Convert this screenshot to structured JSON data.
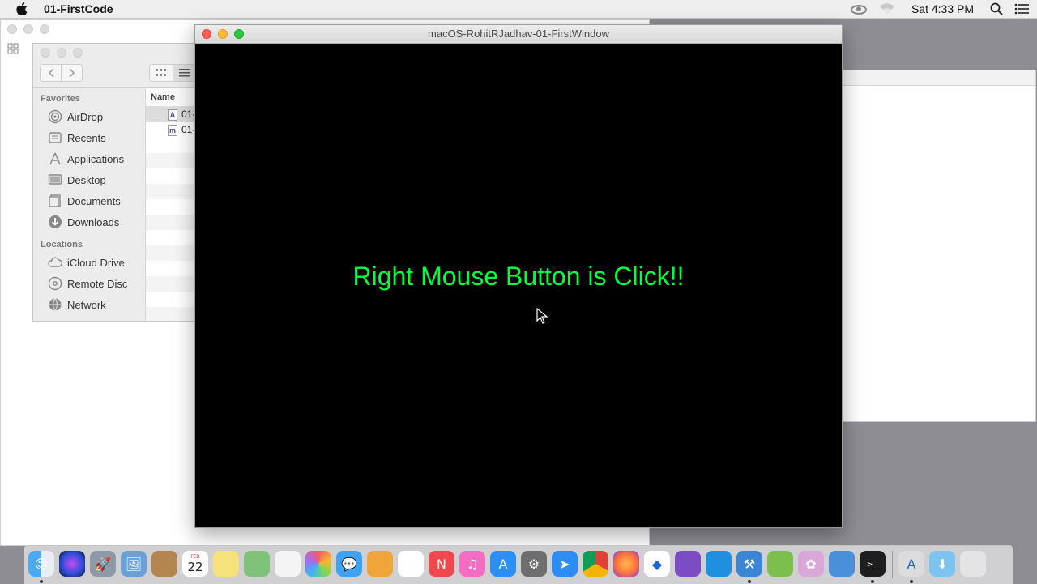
{
  "menubar": {
    "app_name": "01-FirstCode",
    "clock": "Sat 4:33 PM"
  },
  "main_window": {
    "title": "macOS-RohitRJadhav-01-FirstWindow",
    "message": "Right Mouse Button is Click!!",
    "message_color": "#00ff40",
    "background": "#000000"
  },
  "finder": {
    "favorites_heading": "Favorites",
    "locations_heading": "Locations",
    "favorites": [
      {
        "label": "AirDrop",
        "icon": "airdrop-icon"
      },
      {
        "label": "Recents",
        "icon": "recents-icon"
      },
      {
        "label": "Applications",
        "icon": "applications-icon"
      },
      {
        "label": "Desktop",
        "icon": "desktop-icon"
      },
      {
        "label": "Documents",
        "icon": "documents-icon"
      },
      {
        "label": "Downloads",
        "icon": "downloads-icon"
      }
    ],
    "locations": [
      {
        "label": "iCloud Drive",
        "icon": "icloud-icon"
      },
      {
        "label": "Remote Disc",
        "icon": "disc-icon"
      },
      {
        "label": "Network",
        "icon": "network-icon"
      }
    ],
    "column_name": "Name",
    "files": [
      {
        "name": "01-",
        "icon": "app-file-icon"
      },
      {
        "name": "01-",
        "icon": "objc-file-icon"
      }
    ]
  },
  "dock": {
    "apps": [
      "finder",
      "siri",
      "launchpad",
      "preview",
      "contacts",
      "calendar",
      "notes",
      "maps",
      "reminders",
      "photos",
      "messages",
      "pages",
      "numbers",
      "news",
      "itunes",
      "app-store",
      "system-preferences",
      "safari",
      "chrome",
      "firefox",
      "dropbox",
      "visual-studio",
      "vscode",
      "xcode",
      "android-studio",
      "unknown-app",
      "xcode-instruments",
      "terminal",
      "app-file",
      "downloads-folder",
      "trash"
    ],
    "calendar_day": "22",
    "calendar_month": "FEB"
  }
}
